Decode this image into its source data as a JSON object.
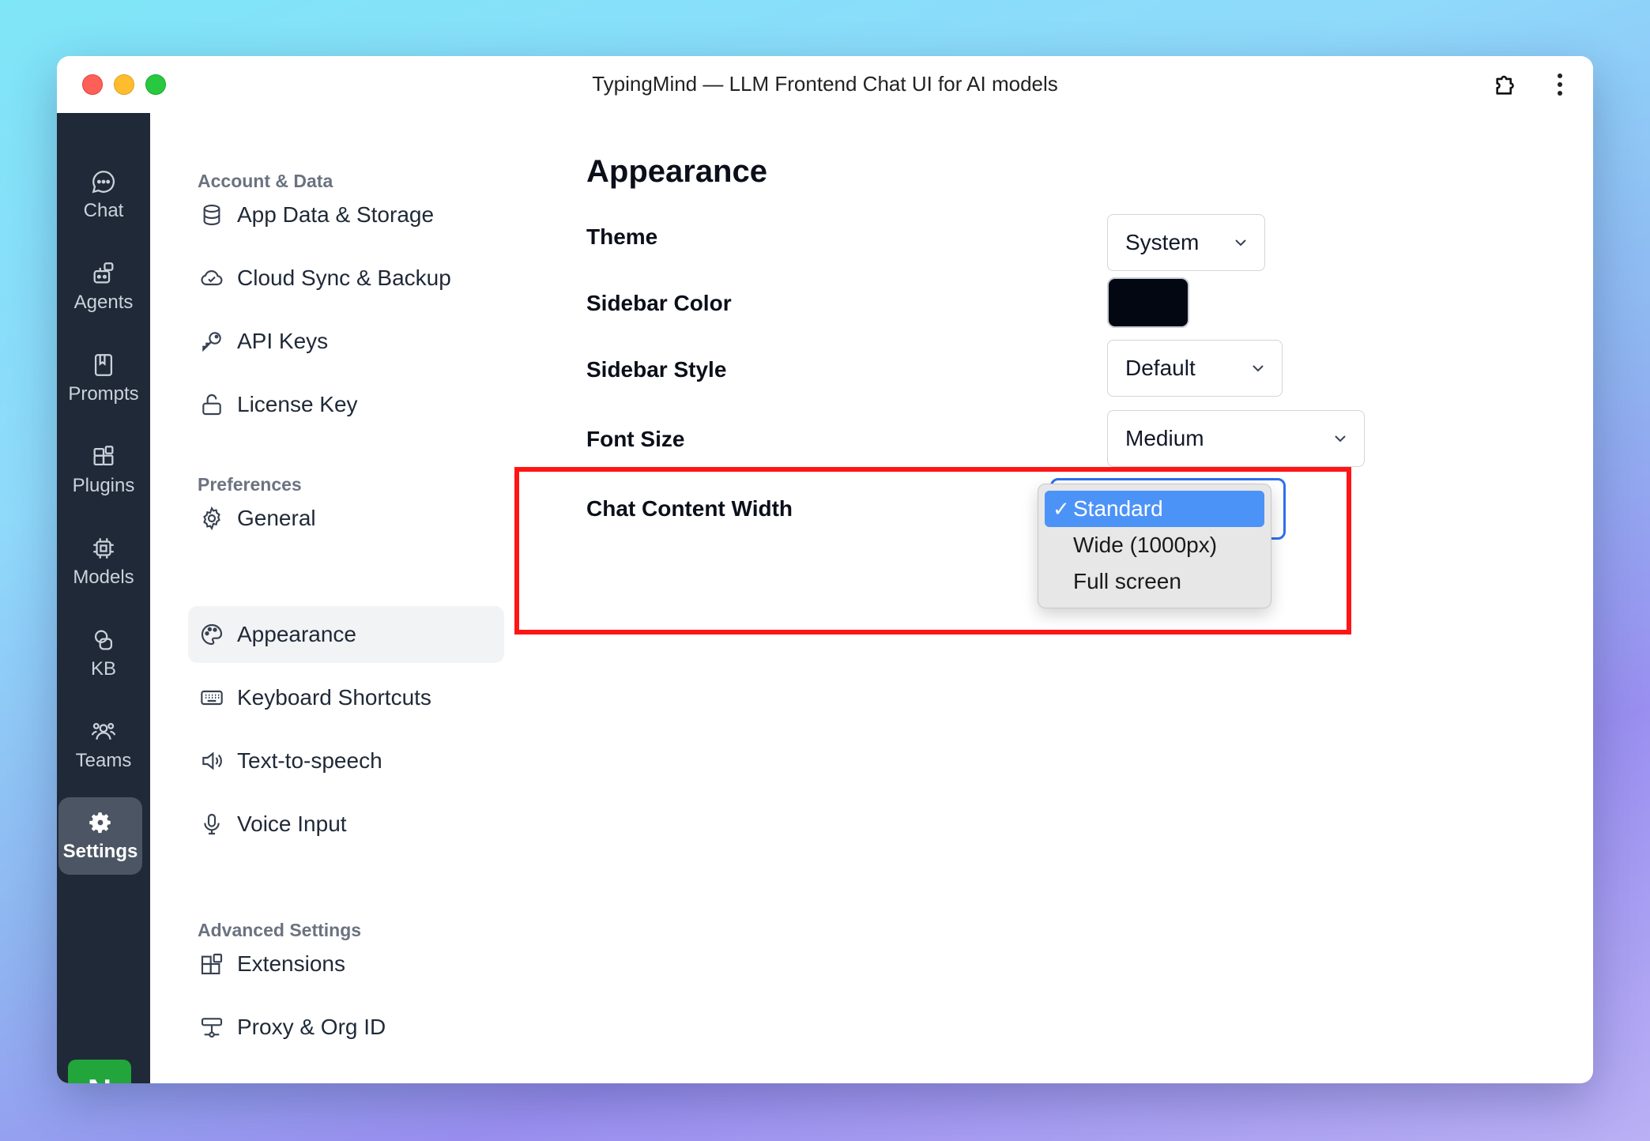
{
  "window": {
    "title": "TypingMind — LLM Frontend Chat UI for AI models"
  },
  "rail": {
    "items": [
      {
        "label": "Chat",
        "icon": "chat-bubble-icon"
      },
      {
        "label": "Agents",
        "icon": "agents-icon"
      },
      {
        "label": "Prompts",
        "icon": "book-icon"
      },
      {
        "label": "Plugins",
        "icon": "plugin-icon"
      },
      {
        "label": "Models",
        "icon": "chip-icon"
      },
      {
        "label": "KB",
        "icon": "documents-icon"
      },
      {
        "label": "Teams",
        "icon": "users-icon"
      },
      {
        "label": "Settings",
        "icon": "gear-icon",
        "active": true
      }
    ],
    "avatar": "N"
  },
  "nav": {
    "sections": {
      "account": "Account & Data",
      "preferences": "Preferences",
      "advanced": "Advanced Settings"
    },
    "items": [
      {
        "label": "App Data & Storage",
        "icon": "database-icon"
      },
      {
        "label": "Cloud Sync & Backup",
        "icon": "cloud-icon"
      },
      {
        "label": "API Keys",
        "icon": "key-icon"
      },
      {
        "label": "License Key",
        "icon": "unlock-icon"
      },
      {
        "label": "General",
        "icon": "gear-icon"
      },
      {
        "label": "Appearance",
        "icon": "palette-icon",
        "active": true
      },
      {
        "label": "Keyboard Shortcuts",
        "icon": "keyboard-icon"
      },
      {
        "label": "Text-to-speech",
        "icon": "speaker-icon"
      },
      {
        "label": "Voice Input",
        "icon": "microphone-icon"
      },
      {
        "label": "Extensions",
        "icon": "extensions-icon"
      },
      {
        "label": "Proxy & Org ID",
        "icon": "proxy-icon"
      }
    ]
  },
  "appearance": {
    "title": "Appearance",
    "theme": {
      "label": "Theme",
      "value": "System"
    },
    "sidebar_color": {
      "label": "Sidebar Color",
      "value": "#030712"
    },
    "sidebar_style": {
      "label": "Sidebar Style",
      "value": "Default"
    },
    "font_size": {
      "label": "Font Size",
      "value": "Medium"
    },
    "chat_content_width": {
      "label": "Chat Content Width",
      "check": "✓",
      "options": [
        "Standard",
        "Wide (1000px)",
        "Full screen"
      ],
      "selected": "Standard"
    }
  },
  "colors": {
    "highlight_box": "#ff1515",
    "accent": "#4c93f7",
    "rail_bg": "#1f2937"
  }
}
